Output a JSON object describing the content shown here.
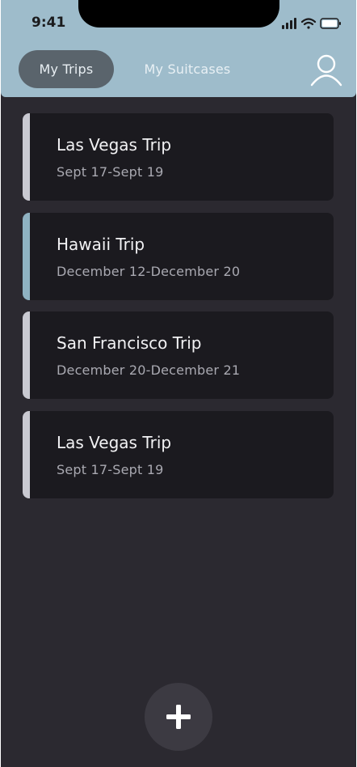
{
  "status_bar": {
    "time": "9:41",
    "icons": [
      "cellular-signal-icon",
      "wifi-icon",
      "battery-icon"
    ]
  },
  "header": {
    "tabs": [
      {
        "label": "My Trips",
        "selected": true
      },
      {
        "label": "My Suitcases",
        "selected": false
      }
    ],
    "profile_icon": "profile-icon"
  },
  "trips": [
    {
      "title": "Las Vegas Trip",
      "dates": "Sept 17-Sept 19",
      "accent": "#c9c9d1"
    },
    {
      "title": "Hawaii Trip",
      "dates": "December 12-December 20",
      "accent": "#8fb2c2"
    },
    {
      "title": "San Francisco Trip",
      "dates": "December 20-December 21",
      "accent": "#c9c9d1"
    },
    {
      "title": "Las Vegas Trip",
      "dates": "Sept 17-Sept 19",
      "accent": "#c9c9d1"
    }
  ],
  "fab": {
    "icon": "plus-icon"
  },
  "colors": {
    "header_bg": "#9ebccb",
    "screen_bg": "#2b2930",
    "card_bg": "#1b1a1f",
    "selected_tab_bg": "#5a646c"
  }
}
